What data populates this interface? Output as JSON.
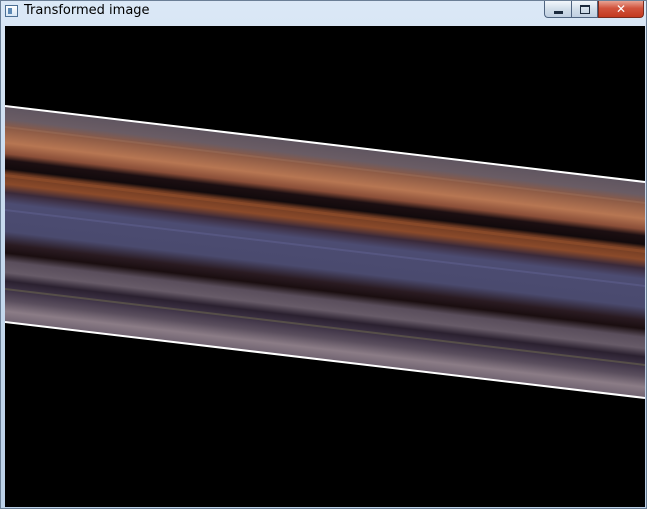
{
  "window": {
    "title": "Transformed image",
    "controls": {
      "minimize_icon": "minimize-icon",
      "maximize_icon": "maximize-icon",
      "close_icon": "close-icon",
      "close_symbol": "✕"
    }
  },
  "canvas": {
    "background": "#000000",
    "border_color": "#ffffff",
    "band_colors": [
      "#5a4e58",
      "#b07050",
      "#1a1014",
      "#7a3d20",
      "#4a4b70",
      "#221418",
      "#5f5261",
      "#2a2430",
      "#8b7a84"
    ]
  }
}
